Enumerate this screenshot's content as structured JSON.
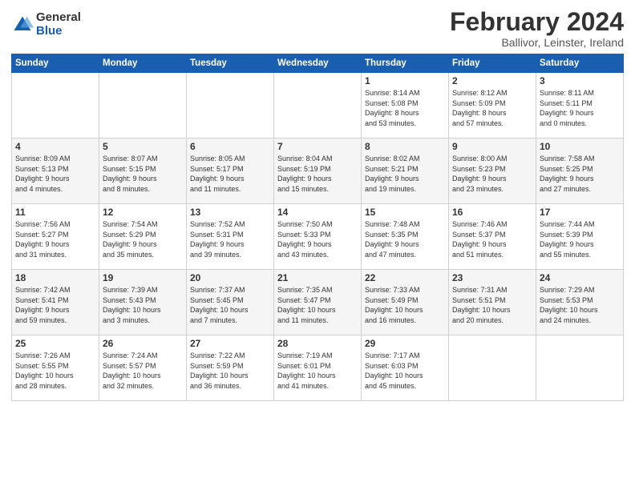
{
  "logo": {
    "general": "General",
    "blue": "Blue"
  },
  "header": {
    "month": "February 2024",
    "location": "Ballivor, Leinster, Ireland"
  },
  "days_of_week": [
    "Sunday",
    "Monday",
    "Tuesday",
    "Wednesday",
    "Thursday",
    "Friday",
    "Saturday"
  ],
  "weeks": [
    [
      {
        "day": "",
        "info": ""
      },
      {
        "day": "",
        "info": ""
      },
      {
        "day": "",
        "info": ""
      },
      {
        "day": "",
        "info": ""
      },
      {
        "day": "1",
        "info": "Sunrise: 8:14 AM\nSunset: 5:08 PM\nDaylight: 8 hours\nand 53 minutes."
      },
      {
        "day": "2",
        "info": "Sunrise: 8:12 AM\nSunset: 5:09 PM\nDaylight: 8 hours\nand 57 minutes."
      },
      {
        "day": "3",
        "info": "Sunrise: 8:11 AM\nSunset: 5:11 PM\nDaylight: 9 hours\nand 0 minutes."
      }
    ],
    [
      {
        "day": "4",
        "info": "Sunrise: 8:09 AM\nSunset: 5:13 PM\nDaylight: 9 hours\nand 4 minutes."
      },
      {
        "day": "5",
        "info": "Sunrise: 8:07 AM\nSunset: 5:15 PM\nDaylight: 9 hours\nand 8 minutes."
      },
      {
        "day": "6",
        "info": "Sunrise: 8:05 AM\nSunset: 5:17 PM\nDaylight: 9 hours\nand 11 minutes."
      },
      {
        "day": "7",
        "info": "Sunrise: 8:04 AM\nSunset: 5:19 PM\nDaylight: 9 hours\nand 15 minutes."
      },
      {
        "day": "8",
        "info": "Sunrise: 8:02 AM\nSunset: 5:21 PM\nDaylight: 9 hours\nand 19 minutes."
      },
      {
        "day": "9",
        "info": "Sunrise: 8:00 AM\nSunset: 5:23 PM\nDaylight: 9 hours\nand 23 minutes."
      },
      {
        "day": "10",
        "info": "Sunrise: 7:58 AM\nSunset: 5:25 PM\nDaylight: 9 hours\nand 27 minutes."
      }
    ],
    [
      {
        "day": "11",
        "info": "Sunrise: 7:56 AM\nSunset: 5:27 PM\nDaylight: 9 hours\nand 31 minutes."
      },
      {
        "day": "12",
        "info": "Sunrise: 7:54 AM\nSunset: 5:29 PM\nDaylight: 9 hours\nand 35 minutes."
      },
      {
        "day": "13",
        "info": "Sunrise: 7:52 AM\nSunset: 5:31 PM\nDaylight: 9 hours\nand 39 minutes."
      },
      {
        "day": "14",
        "info": "Sunrise: 7:50 AM\nSunset: 5:33 PM\nDaylight: 9 hours\nand 43 minutes."
      },
      {
        "day": "15",
        "info": "Sunrise: 7:48 AM\nSunset: 5:35 PM\nDaylight: 9 hours\nand 47 minutes."
      },
      {
        "day": "16",
        "info": "Sunrise: 7:46 AM\nSunset: 5:37 PM\nDaylight: 9 hours\nand 51 minutes."
      },
      {
        "day": "17",
        "info": "Sunrise: 7:44 AM\nSunset: 5:39 PM\nDaylight: 9 hours\nand 55 minutes."
      }
    ],
    [
      {
        "day": "18",
        "info": "Sunrise: 7:42 AM\nSunset: 5:41 PM\nDaylight: 9 hours\nand 59 minutes."
      },
      {
        "day": "19",
        "info": "Sunrise: 7:39 AM\nSunset: 5:43 PM\nDaylight: 10 hours\nand 3 minutes."
      },
      {
        "day": "20",
        "info": "Sunrise: 7:37 AM\nSunset: 5:45 PM\nDaylight: 10 hours\nand 7 minutes."
      },
      {
        "day": "21",
        "info": "Sunrise: 7:35 AM\nSunset: 5:47 PM\nDaylight: 10 hours\nand 11 minutes."
      },
      {
        "day": "22",
        "info": "Sunrise: 7:33 AM\nSunset: 5:49 PM\nDaylight: 10 hours\nand 16 minutes."
      },
      {
        "day": "23",
        "info": "Sunrise: 7:31 AM\nSunset: 5:51 PM\nDaylight: 10 hours\nand 20 minutes."
      },
      {
        "day": "24",
        "info": "Sunrise: 7:29 AM\nSunset: 5:53 PM\nDaylight: 10 hours\nand 24 minutes."
      }
    ],
    [
      {
        "day": "25",
        "info": "Sunrise: 7:26 AM\nSunset: 5:55 PM\nDaylight: 10 hours\nand 28 minutes."
      },
      {
        "day": "26",
        "info": "Sunrise: 7:24 AM\nSunset: 5:57 PM\nDaylight: 10 hours\nand 32 minutes."
      },
      {
        "day": "27",
        "info": "Sunrise: 7:22 AM\nSunset: 5:59 PM\nDaylight: 10 hours\nand 36 minutes."
      },
      {
        "day": "28",
        "info": "Sunrise: 7:19 AM\nSunset: 6:01 PM\nDaylight: 10 hours\nand 41 minutes."
      },
      {
        "day": "29",
        "info": "Sunrise: 7:17 AM\nSunset: 6:03 PM\nDaylight: 10 hours\nand 45 minutes."
      },
      {
        "day": "",
        "info": ""
      },
      {
        "day": "",
        "info": ""
      }
    ]
  ]
}
